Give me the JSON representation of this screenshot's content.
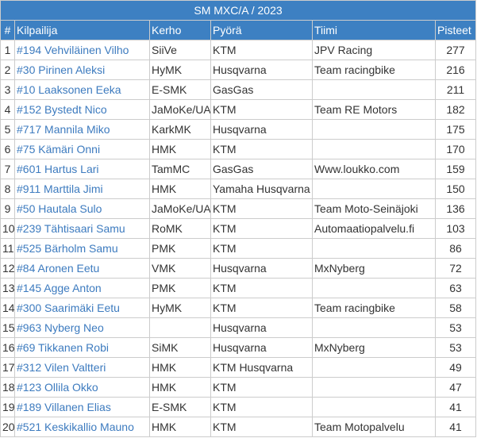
{
  "table": {
    "title": "SM MXC/A / 2023",
    "columns": [
      "#",
      "Kilpailija",
      "Kerho",
      "Pyörä",
      "Tiimi",
      "Pisteet"
    ],
    "rows": [
      {
        "rank": "1",
        "name": "#194 Vehviläinen Vilho",
        "club": "SiiVe",
        "bike": "KTM",
        "team": "JPV Racing",
        "points": "277"
      },
      {
        "rank": "2",
        "name": "#30 Pirinen Aleksi",
        "club": "HyMK",
        "bike": "Husqvarna",
        "team": "Team racingbike",
        "points": "216"
      },
      {
        "rank": "3",
        "name": "#10 Laaksonen Eeka",
        "club": "E-SMK",
        "bike": "GasGas",
        "team": "",
        "points": "211"
      },
      {
        "rank": "4",
        "name": "#152 Bystedt Nico",
        "club": "JaMoKe/UA",
        "bike": "KTM",
        "team": "Team RE Motors",
        "points": "182"
      },
      {
        "rank": "5",
        "name": "#717 Mannila Miko",
        "club": "KarkMK",
        "bike": "Husqvarna",
        "team": "",
        "points": "175"
      },
      {
        "rank": "6",
        "name": "#75 Kämäri Onni",
        "club": "HMK",
        "bike": "KTM",
        "team": "",
        "points": "170"
      },
      {
        "rank": "7",
        "name": "#601 Hartus Lari",
        "club": "TamMC",
        "bike": "GasGas",
        "team": "Www.loukko.com",
        "points": "159"
      },
      {
        "rank": "8",
        "name": "#911 Marttila Jimi",
        "club": "HMK",
        "bike": "Yamaha Husqvarna",
        "team": "",
        "points": "150"
      },
      {
        "rank": "9",
        "name": "#50 Hautala Sulo",
        "club": "JaMoKe/UA",
        "bike": "KTM",
        "team": "Team Moto-Seinäjoki",
        "points": "136"
      },
      {
        "rank": "10",
        "name": "#239 Tähtisaari Samu",
        "club": "RoMK",
        "bike": "KTM",
        "team": "Automaatiopalvelu.fi",
        "points": "103"
      },
      {
        "rank": "11",
        "name": "#525 Bärholm Samu",
        "club": "PMK",
        "bike": "KTM",
        "team": "",
        "points": "86"
      },
      {
        "rank": "12",
        "name": "#84 Aronen Eetu",
        "club": "VMK",
        "bike": "Husqvarna",
        "team": "MxNyberg",
        "points": "72"
      },
      {
        "rank": "13",
        "name": "#145 Agge Anton",
        "club": "PMK",
        "bike": "KTM",
        "team": "",
        "points": "63"
      },
      {
        "rank": "14",
        "name": "#300 Saarimäki Eetu",
        "club": "HyMK",
        "bike": "KTM",
        "team": "Team racingbike",
        "points": "58"
      },
      {
        "rank": "15",
        "name": "#963 Nyberg Neo",
        "club": "",
        "bike": "Husqvarna",
        "team": "",
        "points": "53"
      },
      {
        "rank": "16",
        "name": "#69 Tikkanen Robi",
        "club": "SiMK",
        "bike": "Husqvarna",
        "team": "MxNyberg",
        "points": "53"
      },
      {
        "rank": "17",
        "name": "#312 Vilen Valtteri",
        "club": "HMK",
        "bike": "KTM Husqvarna",
        "team": "",
        "points": "49"
      },
      {
        "rank": "18",
        "name": "#123 Ollila Okko",
        "club": "HMK",
        "bike": "KTM",
        "team": "",
        "points": "47"
      },
      {
        "rank": "19",
        "name": "#189 Villanen Elias",
        "club": "E-SMK",
        "bike": "KTM",
        "team": "",
        "points": "41"
      },
      {
        "rank": "20",
        "name": "#521 Keskikallio Mauno",
        "club": "HMK",
        "bike": "KTM",
        "team": "Team Motopalvelu",
        "points": "41"
      }
    ]
  },
  "colors": {
    "header_bg": "#3d80c2",
    "header_text": "#ffffff",
    "link": "#3d7bbf",
    "border": "#cccccc"
  }
}
